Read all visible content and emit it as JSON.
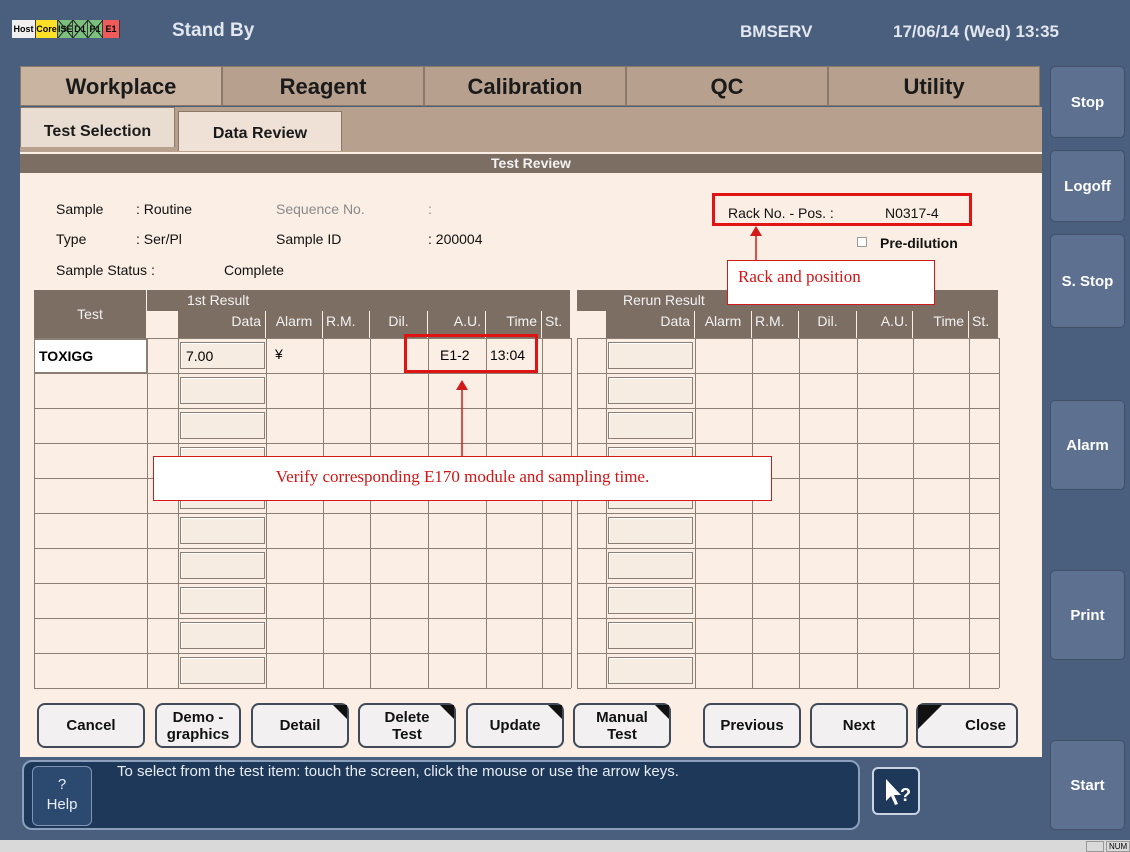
{
  "status_indicators": [
    {
      "label": "Host",
      "color": "#f0f0f0"
    },
    {
      "label": "Core",
      "color": "#ffe227"
    },
    {
      "label": "ISE",
      "color": "#7bc07f"
    },
    {
      "label": "D1",
      "color": "#7bc07f"
    },
    {
      "label": "P1",
      "color": "#7bc07f"
    },
    {
      "label": "E1",
      "color": "#ef5b5b"
    }
  ],
  "header": {
    "mode": "Stand By",
    "server": "BMSERV",
    "datetime": "17/06/14 (Wed) 13:35"
  },
  "main_tabs": [
    "Workplace",
    "Reagent",
    "Calibration",
    "QC",
    "Utility"
  ],
  "sub_tabs": [
    "Test Selection",
    "Data Review"
  ],
  "screen_title": "Test Review",
  "sample": {
    "sample_label": "Sample",
    "sample_value": ": Routine",
    "type_label": "Type",
    "type_value": ": Ser/Pl",
    "status_label": "Sample Status :",
    "status_value": "Complete",
    "seq_label": "Sequence No.",
    "seq_value": ":",
    "id_label": "Sample ID",
    "id_value": ": 200004",
    "rack_label": "Rack No. - Pos. :",
    "rack_value": "N0317-4",
    "predilution_label": "Pre-dilution"
  },
  "table": {
    "test_header": "Test",
    "first_result": "1st Result",
    "rerun_result": "Rerun Result",
    "columns": [
      "Data",
      "Alarm",
      "R.M.",
      "Dil.",
      "A.U.",
      "Time",
      "St."
    ],
    "rows": [
      {
        "test": "TOXIGG",
        "data": "7.00",
        "alarm": "¥",
        "rm": "",
        "dil": "",
        "au": "E1-2",
        "time": "13:04",
        "st": ""
      }
    ]
  },
  "annotations": {
    "rack_callout": "Rack and position",
    "module_callout": "Verify corresponding E170 module and sampling time."
  },
  "buttons": {
    "cancel": "Cancel",
    "demographics": "Demo - graphics",
    "detail": "Detail",
    "delete_test": "Delete Test",
    "update": "Update",
    "manual_test": "Manual Test",
    "previous": "Previous",
    "next": "Next",
    "close": "Close"
  },
  "right_buttons": {
    "stop": "Stop",
    "logoff": "Logoff",
    "s_stop": "S. Stop",
    "alarm": "Alarm",
    "print": "Print",
    "start": "Start"
  },
  "help": {
    "label_q": "?",
    "label": "Help",
    "message": "To select from the test item: touch the screen, click the mouse or use the arrow keys."
  },
  "statusbar": {
    "num": "NUM"
  }
}
